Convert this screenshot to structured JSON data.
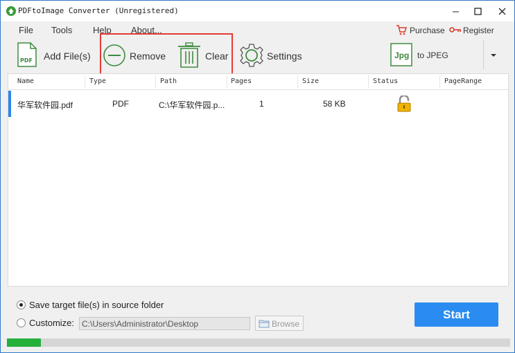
{
  "window": {
    "title": "PDFtoImage Converter (Unregistered)"
  },
  "menu": {
    "items": [
      "File",
      "Tools",
      "Help",
      "About..."
    ]
  },
  "account": {
    "purchase": "Purchase",
    "register": "Register"
  },
  "toolbar": {
    "add_files": "Add File(s)",
    "remove": "Remove",
    "clear": "Clear",
    "settings": "Settings",
    "format_icon_text": "Jpg",
    "format": "to JPEG"
  },
  "table": {
    "columns": [
      "Name",
      "Type",
      "Path",
      "Pages",
      "Size",
      "Status",
      "PageRange"
    ],
    "rows": [
      {
        "name": "华军软件园.pdf",
        "type": "PDF",
        "path": "C:\\华军软件园.p...",
        "pages": "1",
        "size": "58 KB",
        "status_icon": "unlocked-padlock-icon",
        "page_range": ""
      }
    ]
  },
  "output": {
    "option_source": "Save target file(s) in source folder",
    "option_custom": "Customize:",
    "selected": "source",
    "path_value": "C:\\Users\\Administrator\\Desktop",
    "browse": "Browse"
  },
  "start": "Start",
  "progress_fraction": 0.068,
  "colors": {
    "accent": "#2a8cf0",
    "progress": "#25b03a",
    "highlight": "#e53935"
  }
}
